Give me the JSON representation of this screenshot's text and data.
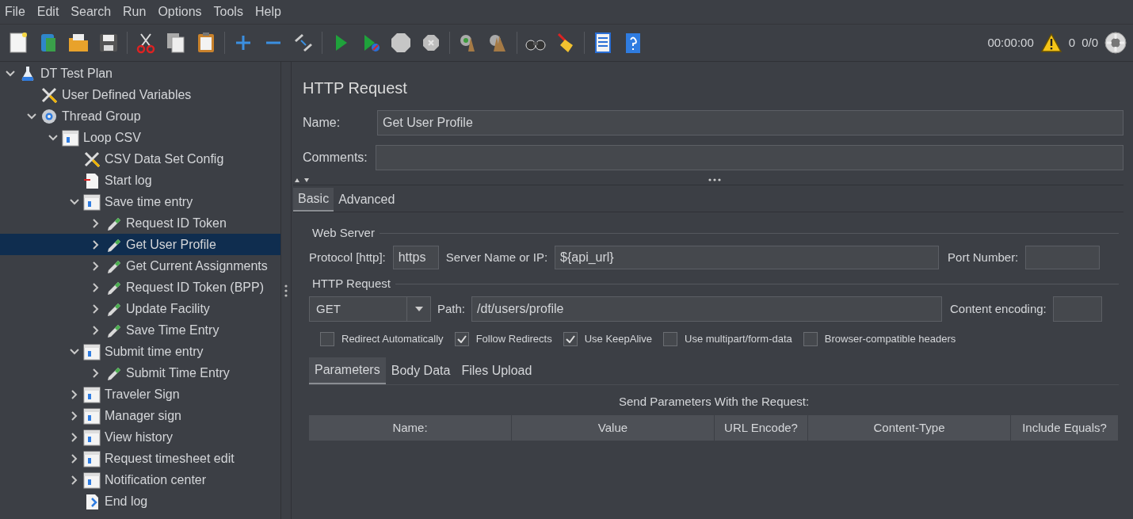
{
  "menu": [
    "File",
    "Edit",
    "Search",
    "Run",
    "Options",
    "Tools",
    "Help"
  ],
  "status": {
    "timer": "00:00:00",
    "warnings": "0",
    "threads": "0/0"
  },
  "tree": [
    {
      "label": "DT Test Plan",
      "kind": "plan",
      "expanded": true,
      "selected": false,
      "children": [
        {
          "label": "User Defined Variables",
          "kind": "config",
          "selected": false
        },
        {
          "label": "Thread Group",
          "kind": "threads",
          "expanded": true,
          "selected": false,
          "children": [
            {
              "label": "Loop CSV",
              "kind": "controller",
              "expanded": true,
              "selected": false,
              "children": [
                {
                  "label": "CSV Data Set Config",
                  "kind": "config",
                  "selected": false
                },
                {
                  "label": "Start log",
                  "kind": "log-start",
                  "selected": false
                },
                {
                  "label": "Save time entry",
                  "kind": "controller",
                  "expanded": true,
                  "selected": false,
                  "children": [
                    {
                      "label": "Request ID Token",
                      "kind": "sampler",
                      "expanded": false,
                      "selected": false
                    },
                    {
                      "label": "Get User Profile",
                      "kind": "sampler",
                      "expanded": false,
                      "selected": true
                    },
                    {
                      "label": "Get Current Assignments",
                      "kind": "sampler",
                      "expanded": false,
                      "selected": false
                    },
                    {
                      "label": "Request ID Token (BPP)",
                      "kind": "sampler",
                      "expanded": false,
                      "selected": false
                    },
                    {
                      "label": "Update Facility",
                      "kind": "sampler",
                      "expanded": false,
                      "selected": false
                    },
                    {
                      "label": "Save Time Entry",
                      "kind": "sampler",
                      "expanded": false,
                      "selected": false
                    }
                  ]
                },
                {
                  "label": "Submit time entry",
                  "kind": "controller",
                  "expanded": true,
                  "selected": false,
                  "children": [
                    {
                      "label": "Submit Time Entry",
                      "kind": "sampler",
                      "expanded": false,
                      "selected": false
                    }
                  ]
                },
                {
                  "label": "Traveler Sign",
                  "kind": "controller",
                  "expanded": false,
                  "selected": false
                },
                {
                  "label": "Manager sign",
                  "kind": "controller",
                  "expanded": false,
                  "selected": false
                },
                {
                  "label": "View history",
                  "kind": "controller",
                  "expanded": false,
                  "selected": false
                },
                {
                  "label": "Request timesheet edit",
                  "kind": "controller",
                  "expanded": false,
                  "selected": false
                },
                {
                  "label": "Notification center",
                  "kind": "controller",
                  "expanded": false,
                  "selected": false
                },
                {
                  "label": "End log",
                  "kind": "log-end",
                  "selected": false
                }
              ]
            }
          ]
        }
      ]
    }
  ],
  "editor": {
    "title": "HTTP Request",
    "name": {
      "label": "Name:",
      "value": "Get User Profile"
    },
    "comments": {
      "label": "Comments:"
    },
    "tabs": [
      {
        "label": "Basic",
        "selected": true
      },
      {
        "label": "Advanced",
        "selected": false
      }
    ],
    "web_server": {
      "heading": "Web Server",
      "protocol_label": "Protocol [http]:",
      "protocol": "https",
      "server_label": "Server Name or IP:",
      "server": "${api_url}",
      "port_label": "Port Number:"
    },
    "http_request": {
      "heading": "HTTP Request",
      "method": "GET",
      "path_label": "Path:",
      "path": "/dt/users/profile",
      "encoding_label": "Content encoding:"
    },
    "options": [
      {
        "label": "Redirect Automatically",
        "checked": false
      },
      {
        "label": "Follow Redirects",
        "checked": true
      },
      {
        "label": "Use KeepAlive",
        "checked": true
      },
      {
        "label": "Use multipart/form-data",
        "checked": false
      },
      {
        "label": "Browser-compatible headers",
        "checked": false
      }
    ],
    "sub_tabs": [
      {
        "label": "Parameters",
        "selected": true
      },
      {
        "label": "Body Data",
        "selected": false
      },
      {
        "label": "Files Upload",
        "selected": false
      }
    ],
    "table": {
      "caption": "Send Parameters With the Request:",
      "columns": [
        "Name:",
        "Value",
        "URL Encode?",
        "Content-Type",
        "Include Equals?"
      ]
    }
  }
}
